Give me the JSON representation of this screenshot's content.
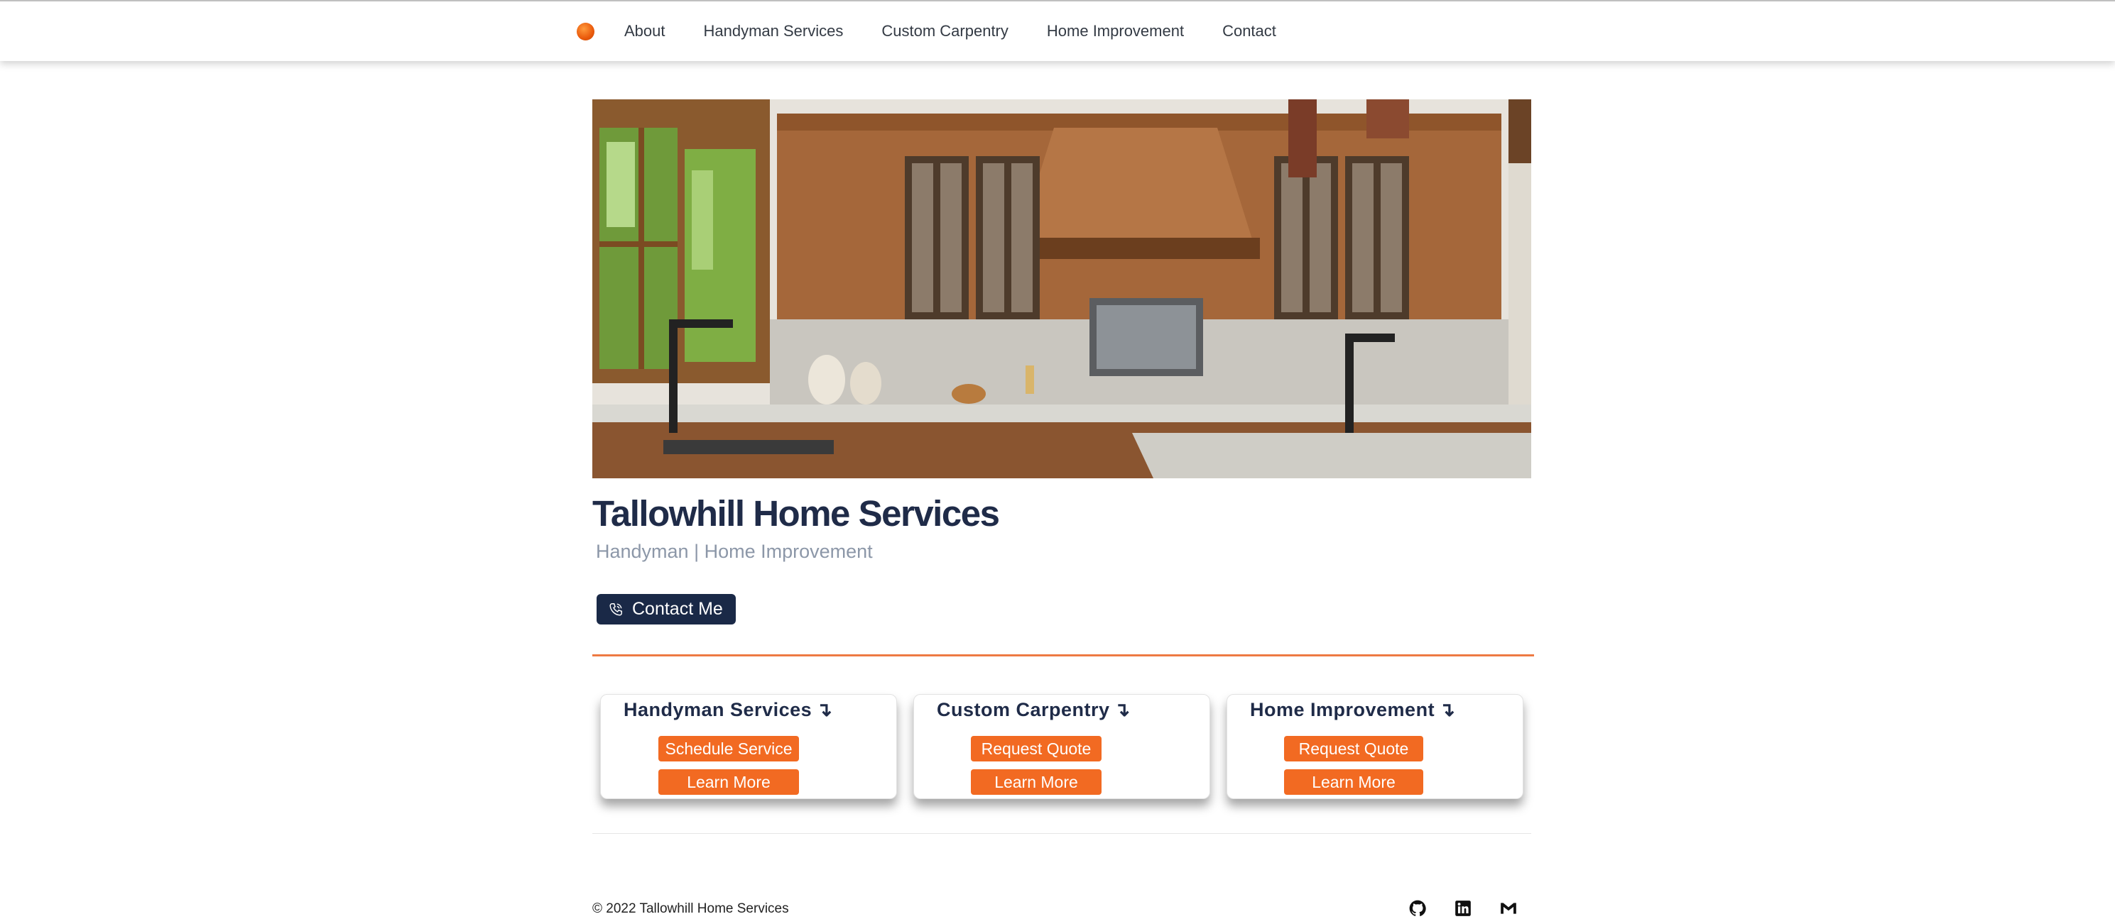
{
  "nav": {
    "logo_icon": "orange-circle-logo-icon",
    "links": [
      "About",
      "Handyman Services",
      "Custom Carpentry",
      "Home Improvement",
      "Contact"
    ]
  },
  "hero": {
    "title": "Tallowhill Home Services",
    "subtitle": "Handyman | Home Improvement",
    "contact_button": "Contact Me",
    "contact_icon": "phone-icon"
  },
  "cards": [
    {
      "title": "Handyman Services",
      "arrow": "↴",
      "primary": "Schedule Service",
      "secondary": "Learn More"
    },
    {
      "title": "Custom Carpentry",
      "arrow": "↴",
      "primary": "Request Quote",
      "secondary": "Learn More"
    },
    {
      "title": "Home Improvement",
      "arrow": "↴",
      "primary": "Request Quote",
      "secondary": "Learn More"
    }
  ],
  "footer": {
    "copyright": "© 2022 Tallowhill Home Services",
    "icons": [
      "github-icon",
      "linkedin-icon",
      "gmail-icon"
    ]
  },
  "colors": {
    "navy": "#1a2947",
    "orange": "#f26a22",
    "divider": "#ee7a43"
  }
}
